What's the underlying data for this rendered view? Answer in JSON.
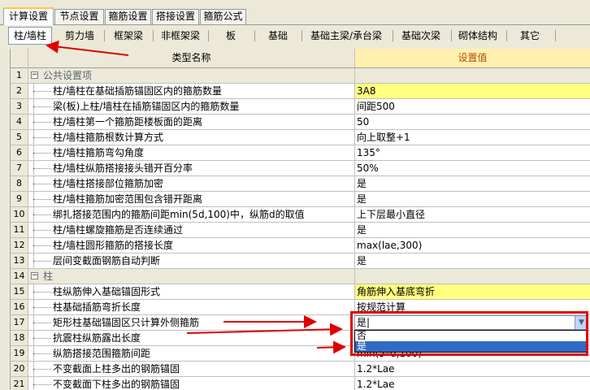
{
  "top_tabs": [
    "计算设置",
    "节点设置",
    "箍筋设置",
    "搭接设置",
    "箍筋公式"
  ],
  "sub_tabs": [
    "柱/墙柱",
    "剪力墙",
    "框架梁",
    "非框架梁",
    "板",
    "基础",
    "基础主梁/承台梁",
    "基础次梁",
    "砌体结构",
    "其它"
  ],
  "grid": {
    "header_name": "类型名称",
    "header_value": "设置值",
    "rows": [
      {
        "num": "1",
        "name": "公共设置项",
        "value": "",
        "group": true,
        "expander": "−"
      },
      {
        "num": "2",
        "name": "柱/墙柱在基础插筋锚固区内的箍筋数量",
        "value": "3A8",
        "yellow": true
      },
      {
        "num": "3",
        "name": "梁(板)上柱/墙柱在插筋锚固区内的箍筋数量",
        "value": "间距500"
      },
      {
        "num": "4",
        "name": "柱/墙柱第一个箍筋距楼板面的距离",
        "value": "50"
      },
      {
        "num": "5",
        "name": "柱/墙柱箍筋根数计算方式",
        "value": "向上取整+1"
      },
      {
        "num": "6",
        "name": "柱/墙柱箍筋弯勾角度",
        "value": "135°"
      },
      {
        "num": "7",
        "name": "柱/墙柱纵筋搭接接头错开百分率",
        "value": "50%"
      },
      {
        "num": "8",
        "name": "柱/墙柱搭接部位箍筋加密",
        "value": "是"
      },
      {
        "num": "9",
        "name": "柱/墙柱箍筋加密范围包含错开距离",
        "value": "是"
      },
      {
        "num": "10",
        "name": "绑扎搭接范围内的箍筋间距min(5d,100)中，纵筋d的取值",
        "value": "上下层最小直径"
      },
      {
        "num": "11",
        "name": "柱/墙柱螺旋箍筋是否连续通过",
        "value": "是"
      },
      {
        "num": "12",
        "name": "柱/墙柱圆形箍筋的搭接长度",
        "value": "max(lae,300)"
      },
      {
        "num": "13",
        "name": "层间变截面钢筋自动判断",
        "value": "是"
      },
      {
        "num": "14",
        "name": "柱",
        "value": "",
        "group": true,
        "expander": "−"
      },
      {
        "num": "15",
        "name": "柱纵筋伸入基础锚固形式",
        "value": "角筋伸入基底弯折",
        "yellow": true
      },
      {
        "num": "16",
        "name": "柱基础插筋弯折长度",
        "value": "按规范计算"
      },
      {
        "num": "17",
        "name": "矩形柱基础锚固区只计算外侧箍筋",
        "value": "是"
      },
      {
        "num": "18",
        "name": "抗震柱纵筋露出长度",
        "value": ""
      },
      {
        "num": "19",
        "name": "纵筋搭接范围箍筋间距",
        "value": "min(5*d,100)"
      },
      {
        "num": "20",
        "name": "不变截面上柱多出的钢筋锚固",
        "value": "1.2*Lae"
      },
      {
        "num": "21",
        "name": "不变截面下柱多出的钢筋锚固",
        "value": "1.2*Lae"
      }
    ]
  },
  "dropdown": {
    "current": "是|",
    "options": [
      "否",
      "是"
    ],
    "selected": "是"
  },
  "colors": {
    "annotation": "#e00000",
    "selection": "#316ac5",
    "highlight": "#ffff80"
  }
}
